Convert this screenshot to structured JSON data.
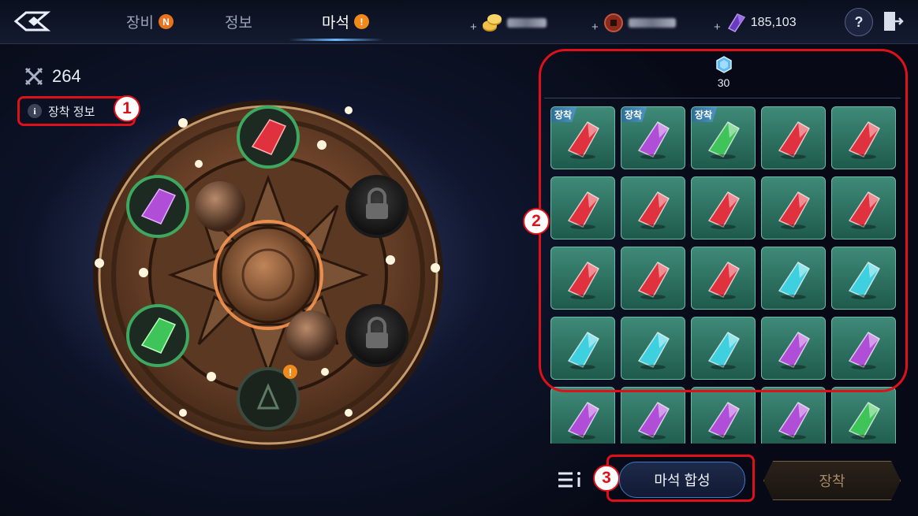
{
  "topbar": {
    "tabs": [
      {
        "label": "장비",
        "badge": "N"
      },
      {
        "label": "정보",
        "badge": ""
      },
      {
        "label": "마석",
        "badge": "!"
      }
    ],
    "currencies": [
      {
        "icon": "gold-coins-icon",
        "value": ""
      },
      {
        "icon": "copper-coin-icon",
        "value": ""
      },
      {
        "icon": "purple-crystal-icon",
        "value": "185,103"
      }
    ],
    "help_label": "?"
  },
  "left": {
    "power_value": "264",
    "equip_info_label": "장착 정보",
    "marker_1": "1",
    "slot_alert": "!"
  },
  "panel": {
    "gem_count": "30",
    "marker_2": "2",
    "equip_tag": "장착",
    "gems": [
      {
        "color": "red",
        "equipped": true
      },
      {
        "color": "purple",
        "equipped": true
      },
      {
        "color": "green",
        "equipped": true
      },
      {
        "color": "red",
        "equipped": false
      },
      {
        "color": "red",
        "equipped": false
      },
      {
        "color": "red",
        "equipped": false
      },
      {
        "color": "red",
        "equipped": false
      },
      {
        "color": "red",
        "equipped": false
      },
      {
        "color": "red",
        "equipped": false
      },
      {
        "color": "red",
        "equipped": false
      },
      {
        "color": "red",
        "equipped": false
      },
      {
        "color": "red",
        "equipped": false
      },
      {
        "color": "red",
        "equipped": false
      },
      {
        "color": "cyan",
        "equipped": false
      },
      {
        "color": "cyan",
        "equipped": false
      },
      {
        "color": "cyan",
        "equipped": false
      },
      {
        "color": "cyan",
        "equipped": false
      },
      {
        "color": "cyan",
        "equipped": false
      },
      {
        "color": "purple",
        "equipped": false
      },
      {
        "color": "purple",
        "equipped": false
      },
      {
        "color": "purple",
        "equipped": false
      },
      {
        "color": "purple",
        "equipped": false
      },
      {
        "color": "purple",
        "equipped": false
      },
      {
        "color": "purple",
        "equipped": false
      },
      {
        "color": "green",
        "equipped": false
      }
    ]
  },
  "bottom": {
    "marker_3": "3",
    "synthesize_label": "마석 합성",
    "equip_label": "장착"
  },
  "colors": {
    "red": "#e0323e",
    "purple": "#b04ed8",
    "green": "#3fc45a",
    "cyan": "#3fd0e0",
    "highlight": "#e0101a"
  }
}
